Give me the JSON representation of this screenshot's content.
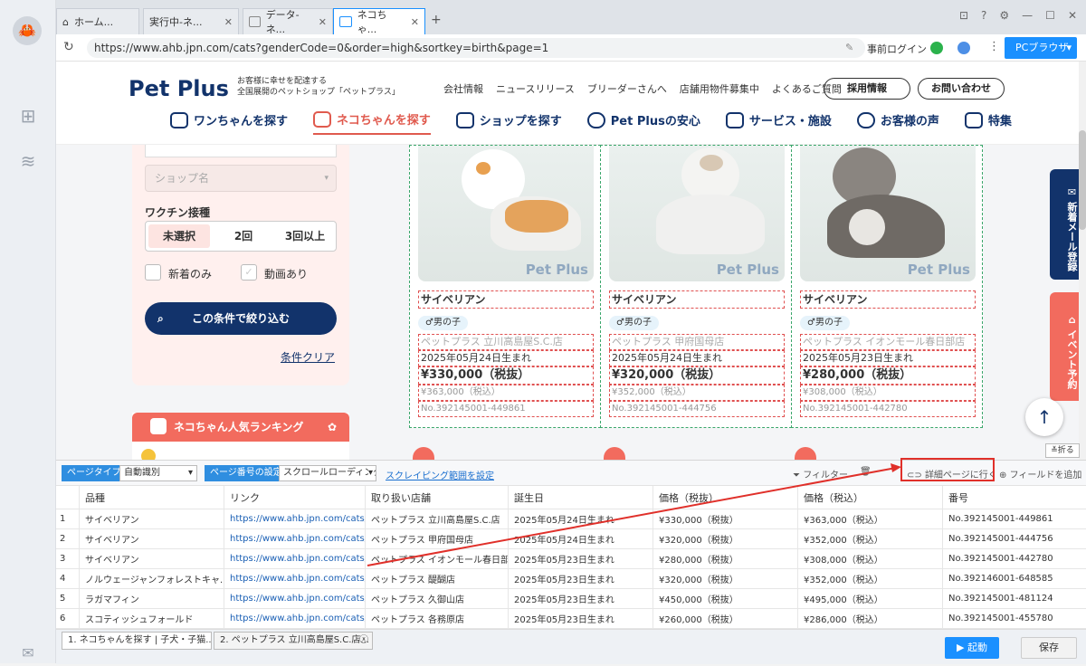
{
  "tabs": [
    {
      "label": "ホーム...",
      "active": false
    },
    {
      "label": "実行中-ネ...",
      "active": false
    },
    {
      "label": "データ-ネ...",
      "active": false
    },
    {
      "label": "ネコちゃ...",
      "active": true
    }
  ],
  "new_tab": "+",
  "address": {
    "url": "https://www.ahb.jpn.com/cats?genderCode=0&order=high&sortkey=birth&page=1",
    "prelogin": "事前ログイン",
    "browser_mode": "PCブラウザ"
  },
  "site": {
    "logo": "Pet Plus",
    "tagline1": "お客様に幸せを配達する",
    "tagline2": "全国展開のペットショップ「ペットプラス」",
    "topnav": [
      "会社情報",
      "ニュースリリース",
      "ブリーダーさんへ",
      "店舗用物件募集中",
      "よくあるご質問"
    ],
    "recruit": "採用情報",
    "contact": "お問い合わせ",
    "mainnav": [
      "ワンちゃんを探す",
      "ネコちゃんを探す",
      "ショップを探す",
      "Pet Plusの安心",
      "サービス・施設",
      "お客様の声",
      "特集"
    ]
  },
  "filter": {
    "shop_placeholder": "ショップ名",
    "vaccine_label": "ワクチン接種",
    "vaccine_options": [
      "未選択",
      "2回",
      "3回以上"
    ],
    "new_only": "新着のみ",
    "video": "動画あり",
    "search_button": "この条件で絞り込む",
    "clear": "条件クリア"
  },
  "ranking": {
    "title": "ネコちゃん人気ランキング"
  },
  "cards": [
    {
      "breed": "サイベリアン",
      "gender": "♂男の子",
      "shop": "ペットプラス 立川高島屋S.C.店",
      "birth": "2025年05月24日生まれ",
      "price": "¥330,000（税抜）",
      "price_tax": "¥363,000（税込）",
      "no": "No.392145001-449861",
      "watermark": "Pet Plus"
    },
    {
      "breed": "サイベリアン",
      "gender": "♂男の子",
      "shop": "ペットプラス 甲府国母店",
      "birth": "2025年05月24日生まれ",
      "price": "¥320,000（税抜）",
      "price_tax": "¥352,000（税込）",
      "no": "No.392145001-444756",
      "watermark": "Pet Plus"
    },
    {
      "breed": "サイベリアン",
      "gender": "♂男の子",
      "shop": "ペットプラス イオンモール春日部店",
      "birth": "2025年05月23日生まれ",
      "price": "¥280,000（税抜）",
      "price_tax": "¥308,000（税込）",
      "no": "No.392145001-442780",
      "watermark": "Pet Plus"
    }
  ],
  "side": {
    "mail": "新着メール登録",
    "event": "イベント予約",
    "collapse": "折る",
    "top": "↑"
  },
  "panel": {
    "page_type_label": "ページタイプ",
    "page_type_value": "自動識別",
    "page_number_label": "ページ番号の設定",
    "page_number_value": "スクロールローディング",
    "scrape_range": "スクレイピング範囲を設定",
    "filter": "フィルター",
    "detail": "詳細ページに行く",
    "add_field": "フィールドを追加",
    "columns": [
      "品種",
      "リンク",
      "取り扱い店舗",
      "誕生日",
      "価格（税抜）",
      "価格（税込）",
      "番号"
    ],
    "rows": [
      [
        "1",
        "サイベリアン",
        "https://www.ahb.jpn.com/cats/1001...",
        "ペットプラス 立川高島屋S.C.店",
        "2025年05月24日生まれ",
        "¥330,000（税抜）",
        "¥363,000（税込）",
        "No.392145001-449861"
      ],
      [
        "2",
        "サイベリアン",
        "https://www.ahb.jpn.com/cats/1001...",
        "ペットプラス 甲府国母店",
        "2025年05月24日生まれ",
        "¥320,000（税抜）",
        "¥352,000（税込）",
        "No.392145001-444756"
      ],
      [
        "3",
        "サイベリアン",
        "https://www.ahb.jpn.com/cats/1001...",
        "ペットプラス イオンモール春日部店",
        "2025年05月23日生まれ",
        "¥280,000（税抜）",
        "¥308,000（税込）",
        "No.392145001-442780"
      ],
      [
        "4",
        "ノルウェージャンフォレストキャ...",
        "https://www.ahb.jpn.com/cats/3000...",
        "ペットプラス 醍醐店",
        "2025年05月23日生まれ",
        "¥320,000（税抜）",
        "¥352,000（税込）",
        "No.392146001-648585"
      ],
      [
        "5",
        "ラガマフィン",
        "https://www.ahb.jpn.com/cats/1001...",
        "ペットプラス 久御山店",
        "2025年05月23日生まれ",
        "¥450,000（税抜）",
        "¥495,000（税込）",
        "No.392145001-481124"
      ],
      [
        "6",
        "スコティッシュフォールド",
        "https://www.ahb.jpn.com/cats/2000...",
        "ペットプラス 各務原店",
        "2025年05月23日生まれ",
        "¥260,000（税抜）",
        "¥286,000（税込）",
        "No.392145001-455780"
      ]
    ],
    "bottom_tabs": [
      "1. ネコちゃんを探す | 子犬・子猫...",
      "2. ペットプラス 立川高島屋S.C.店..."
    ],
    "run": "▶ 起動",
    "save": "保存"
  },
  "colors": {
    "navy": "#12336b",
    "coral": "#f26b5e",
    "accent": "#1a90ff",
    "highlight": "#e0302a"
  }
}
